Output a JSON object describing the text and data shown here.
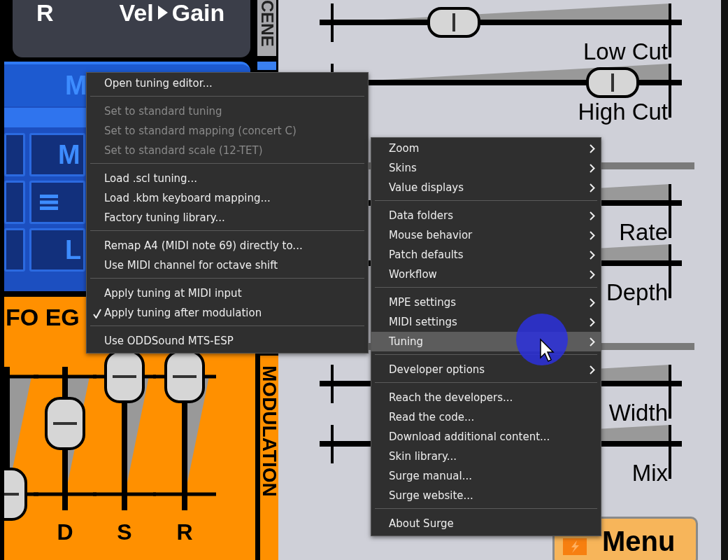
{
  "scene_panel": {
    "left_label": "R",
    "mod_source": "Vel",
    "mod_target": "Gain"
  },
  "scene_tab": {
    "label": "CENE"
  },
  "blue_panel": {
    "header": "M",
    "tiles": [
      {
        "kind": "text",
        "text": "M"
      },
      {
        "kind": "list_icon"
      },
      {
        "kind": "text",
        "text": "L"
      }
    ]
  },
  "envelope": {
    "title": "FO EG",
    "slider_labels": [
      "D",
      "S",
      "R"
    ]
  },
  "modulation_tab": {
    "label": "MODULATION"
  },
  "fx_sections": [
    {
      "sliders": [
        {
          "label": "Low Cut"
        },
        {
          "label": "High Cut"
        }
      ]
    },
    {
      "sliders": [
        {
          "label": "Rate"
        },
        {
          "label": "Depth"
        }
      ]
    },
    {
      "sliders": [
        {
          "label": "Width"
        },
        {
          "label": "Mix"
        }
      ]
    }
  ],
  "menu_button": {
    "label": "Menu"
  },
  "tuning_submenu": {
    "groups": [
      [
        {
          "label": "Open tuning editor...",
          "disabled": false,
          "checked": false
        }
      ],
      [
        {
          "label": "Set to standard tuning",
          "disabled": true,
          "checked": false
        },
        {
          "label": "Set to standard mapping (concert C)",
          "disabled": true,
          "checked": false
        },
        {
          "label": "Set to standard scale (12-TET)",
          "disabled": true,
          "checked": false
        }
      ],
      [
        {
          "label": "Load .scl tuning...",
          "disabled": false,
          "checked": false
        },
        {
          "label": "Load .kbm keyboard mapping...",
          "disabled": false,
          "checked": false
        },
        {
          "label": "Factory tuning library...",
          "disabled": false,
          "checked": false
        }
      ],
      [
        {
          "label": "Remap A4 (MIDI note 69) directly to...",
          "disabled": false,
          "checked": false
        },
        {
          "label": "Use MIDI channel for octave shift",
          "disabled": false,
          "checked": false
        }
      ],
      [
        {
          "label": "Apply tuning at MIDI input",
          "disabled": false,
          "checked": false
        },
        {
          "label": "Apply tuning after modulation",
          "disabled": false,
          "checked": true
        }
      ],
      [
        {
          "label": "Use ODDSound MTS-ESP",
          "disabled": false,
          "checked": false
        }
      ]
    ]
  },
  "main_menu": {
    "groups": [
      [
        {
          "label": "Zoom",
          "has_submenu": true,
          "selected": false
        },
        {
          "label": "Skins",
          "has_submenu": true,
          "selected": false
        },
        {
          "label": "Value displays",
          "has_submenu": true,
          "selected": false
        }
      ],
      [
        {
          "label": "Data folders",
          "has_submenu": true,
          "selected": false
        },
        {
          "label": "Mouse behavior",
          "has_submenu": true,
          "selected": false
        },
        {
          "label": "Patch defaults",
          "has_submenu": true,
          "selected": false
        },
        {
          "label": "Workflow",
          "has_submenu": true,
          "selected": false
        }
      ],
      [
        {
          "label": "MPE settings",
          "has_submenu": true,
          "selected": false
        },
        {
          "label": "MIDI settings",
          "has_submenu": true,
          "selected": false
        },
        {
          "label": "Tuning",
          "has_submenu": true,
          "selected": true
        }
      ],
      [
        {
          "label": "Developer options",
          "has_submenu": true,
          "selected": false
        }
      ],
      [
        {
          "label": "Reach the developers...",
          "has_submenu": false,
          "selected": false
        },
        {
          "label": "Read the code...",
          "has_submenu": false,
          "selected": false
        },
        {
          "label": "Download additional content...",
          "has_submenu": false,
          "selected": false
        },
        {
          "label": "Skin library...",
          "has_submenu": false,
          "selected": false
        },
        {
          "label": "Surge manual...",
          "has_submenu": false,
          "selected": false
        },
        {
          "label": "Surge website...",
          "has_submenu": false,
          "selected": false
        }
      ],
      [
        {
          "label": "About Surge",
          "has_submenu": false,
          "selected": false
        }
      ]
    ]
  }
}
